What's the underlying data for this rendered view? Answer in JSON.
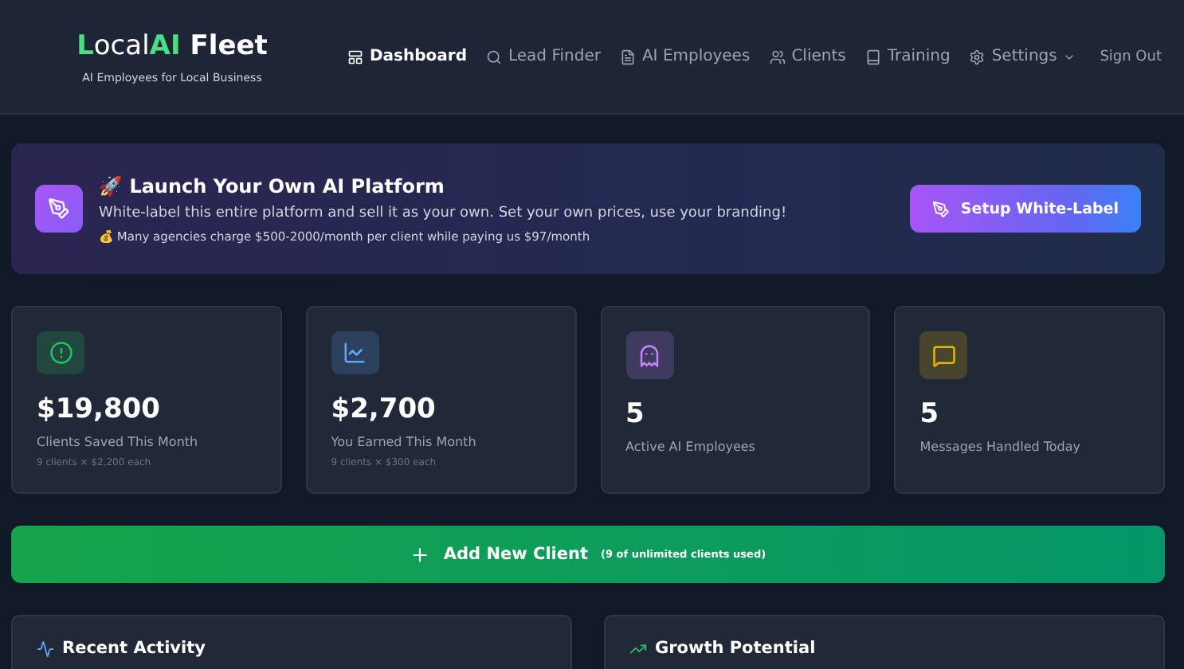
{
  "brand": {
    "logo_initial": "L",
    "logo_text": "ocal",
    "logo_accent": "AI",
    "logo_rest": "Fleet",
    "tagline": "AI Employees for Local Business"
  },
  "nav": [
    {
      "label": "Dashboard",
      "selected": true,
      "has_menu": false
    },
    {
      "label": "Lead Finder",
      "selected": false,
      "has_menu": false
    },
    {
      "label": "AI Employees",
      "selected": false,
      "has_menu": false
    },
    {
      "label": "Clients",
      "selected": false,
      "has_menu": false
    },
    {
      "label": "Training",
      "selected": false,
      "has_menu": false
    },
    {
      "label": "Settings",
      "selected": false,
      "has_menu": true
    }
  ],
  "sign_out": "Sign Out",
  "banner": {
    "emoji": "🚀",
    "title": "Launch Your Own AI Platform",
    "text": "White-label this entire platform and sell it as your own. Set your own prices, use your branding!",
    "note_emoji": "💰",
    "note": "Many agencies charge $500-2000/month per client while paying us $97/month",
    "button": "Setup White-Label"
  },
  "stats": [
    {
      "color": "#22c55e",
      "value": "$19,800",
      "label": "Clients Saved This Month",
      "detail": "9 clients × $2,200 each"
    },
    {
      "color": "#60a5fa",
      "value": "$2,700",
      "label": "You Earned This Month",
      "detail": "9 clients × $300 each"
    },
    {
      "color": "#c084fc",
      "value": "5",
      "label": "Active AI Employees"
    },
    {
      "color": "#eab308",
      "value": "5",
      "label": "Messages Handled Today"
    }
  ],
  "add_client": {
    "label": "Add New Client",
    "note": "(9 of unlimited clients used)"
  },
  "panels": [
    {
      "title": "Recent Activity"
    },
    {
      "title": "Growth Potential"
    }
  ]
}
